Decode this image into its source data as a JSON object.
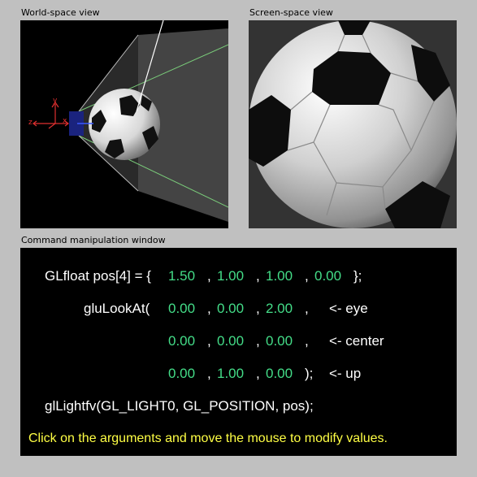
{
  "panels": {
    "world_title": "World-space view",
    "screen_title": "Screen-space view",
    "command_title": "Command manipulation window"
  },
  "axes": {
    "y": "y",
    "z": "z",
    "x": "x"
  },
  "command": {
    "light_prefix": "GLfloat pos[4] = {",
    "light_suffix": "};",
    "pos": [
      "1.50",
      "1.00",
      "1.00",
      "0.00"
    ],
    "lookat_prefix": "gluLookAt(",
    "eye": [
      "0.00",
      "0.00",
      "2.00"
    ],
    "center": [
      "0.00",
      "0.00",
      "0.00"
    ],
    "up": [
      "0.00",
      "1.00",
      "0.00"
    ],
    "eye_comment": "<- eye",
    "center_comment": "<- center",
    "up_comment": "<- up",
    "up_close": ");",
    "lightfv": "glLightfv(GL_LIGHT0, GL_POSITION, pos);",
    "hint": "Click on the arguments and move the mouse to modify values."
  },
  "colors": {
    "value": "#44dd88",
    "hint": "#ffff44"
  }
}
